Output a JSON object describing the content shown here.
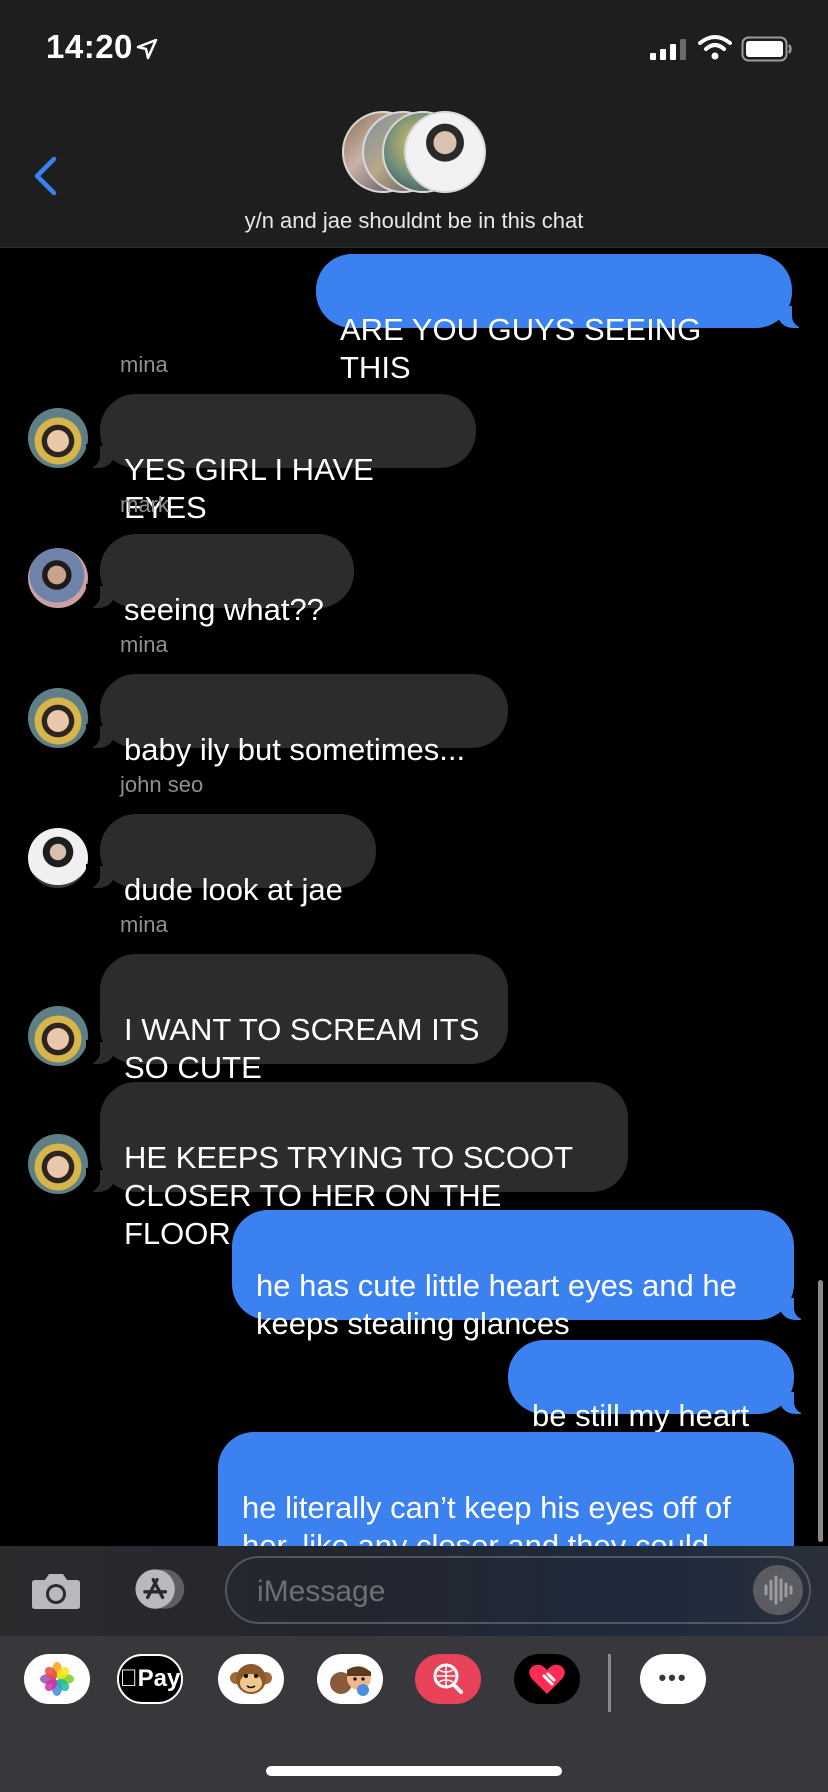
{
  "status_bar": {
    "time": "14:20"
  },
  "header": {
    "group_name": "y/n and jae shouldnt be in this chat"
  },
  "messages": [
    {
      "sender": "",
      "text": "ARE YOU GUYS SEEING THIS",
      "outgoing": true
    },
    {
      "sender": "mina",
      "text": "YES GIRL I HAVE EYES",
      "outgoing": false
    },
    {
      "sender": "mark",
      "text": "seeing what??",
      "outgoing": false
    },
    {
      "sender": "mina",
      "text": "baby ily but sometimes...",
      "outgoing": false
    },
    {
      "sender": "john seo",
      "text": "dude look at jae",
      "outgoing": false
    },
    {
      "sender": "mina",
      "text": "I WANT TO SCREAM ITS\nSO CUTE",
      "outgoing": false
    },
    {
      "sender": "",
      "text": "HE KEEPS TRYING TO SCOOT\nCLOSER TO HER ON THE FLOOR",
      "outgoing": false
    },
    {
      "sender": "",
      "text": "he has cute little heart eyes and he\nkeeps stealing glances",
      "outgoing": true
    },
    {
      "sender": "",
      "text": "be still my heart",
      "outgoing": true
    },
    {
      "sender": "",
      "text": "he literally can’t keep his eyes off of\nher, like any closer and they could\nliterally be cuddling",
      "outgoing": true
    }
  ],
  "input": {
    "placeholder": "iMessage"
  },
  "app_drawer": {
    "apple_pay_label": "Pay",
    "more_label": "•••",
    "apps": [
      "photos-app",
      "apple-pay-app",
      "animoji-app",
      "memoji-app",
      "search-images-app",
      "digital-touch-app",
      "more-apps"
    ]
  },
  "colors": {
    "outgoing_bubble": "#3b82f0",
    "incoming_bubble": "#2c2c2e",
    "accent": "#3b82f0",
    "background": "#000000"
  }
}
